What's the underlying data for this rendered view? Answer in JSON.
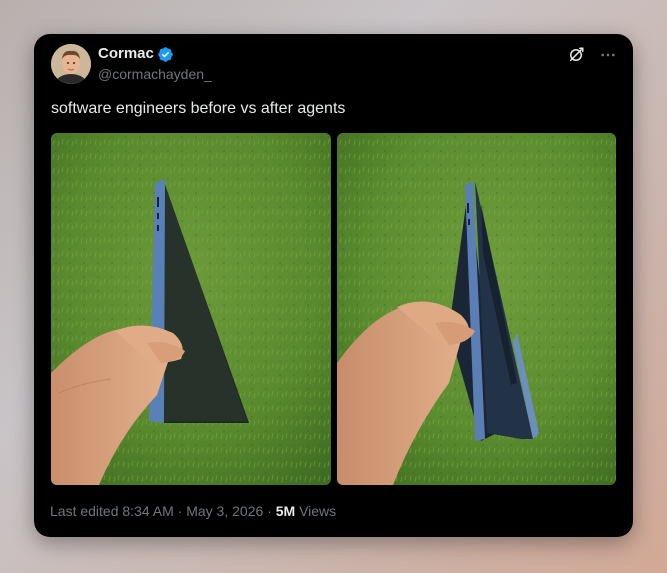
{
  "tweet": {
    "author": {
      "display_name": "Cormac",
      "handle": "@cormachayden_",
      "verified": true,
      "avatar_icon": "profile-photo"
    },
    "text": "software engineers before vs after agents",
    "media": [
      {
        "alt": "Hand holding a closed laptop edge-on over grass"
      },
      {
        "alt": "Hand holding a laptop opened at a slight angle over grass"
      }
    ],
    "footer": {
      "edited_label": "Last edited",
      "time": "8:34 AM",
      "separator": "·",
      "date": "May 3, 2026",
      "views_count": "5M",
      "views_label": "Views"
    }
  },
  "icons": {
    "verified": "verified-badge-icon",
    "grok": "grok-icon",
    "more": "more-options-icon"
  },
  "colors": {
    "card_background": "#000000",
    "primary_text": "#e7e9ea",
    "secondary_text": "#71767b",
    "verified_blue": "#1d9bf0"
  }
}
